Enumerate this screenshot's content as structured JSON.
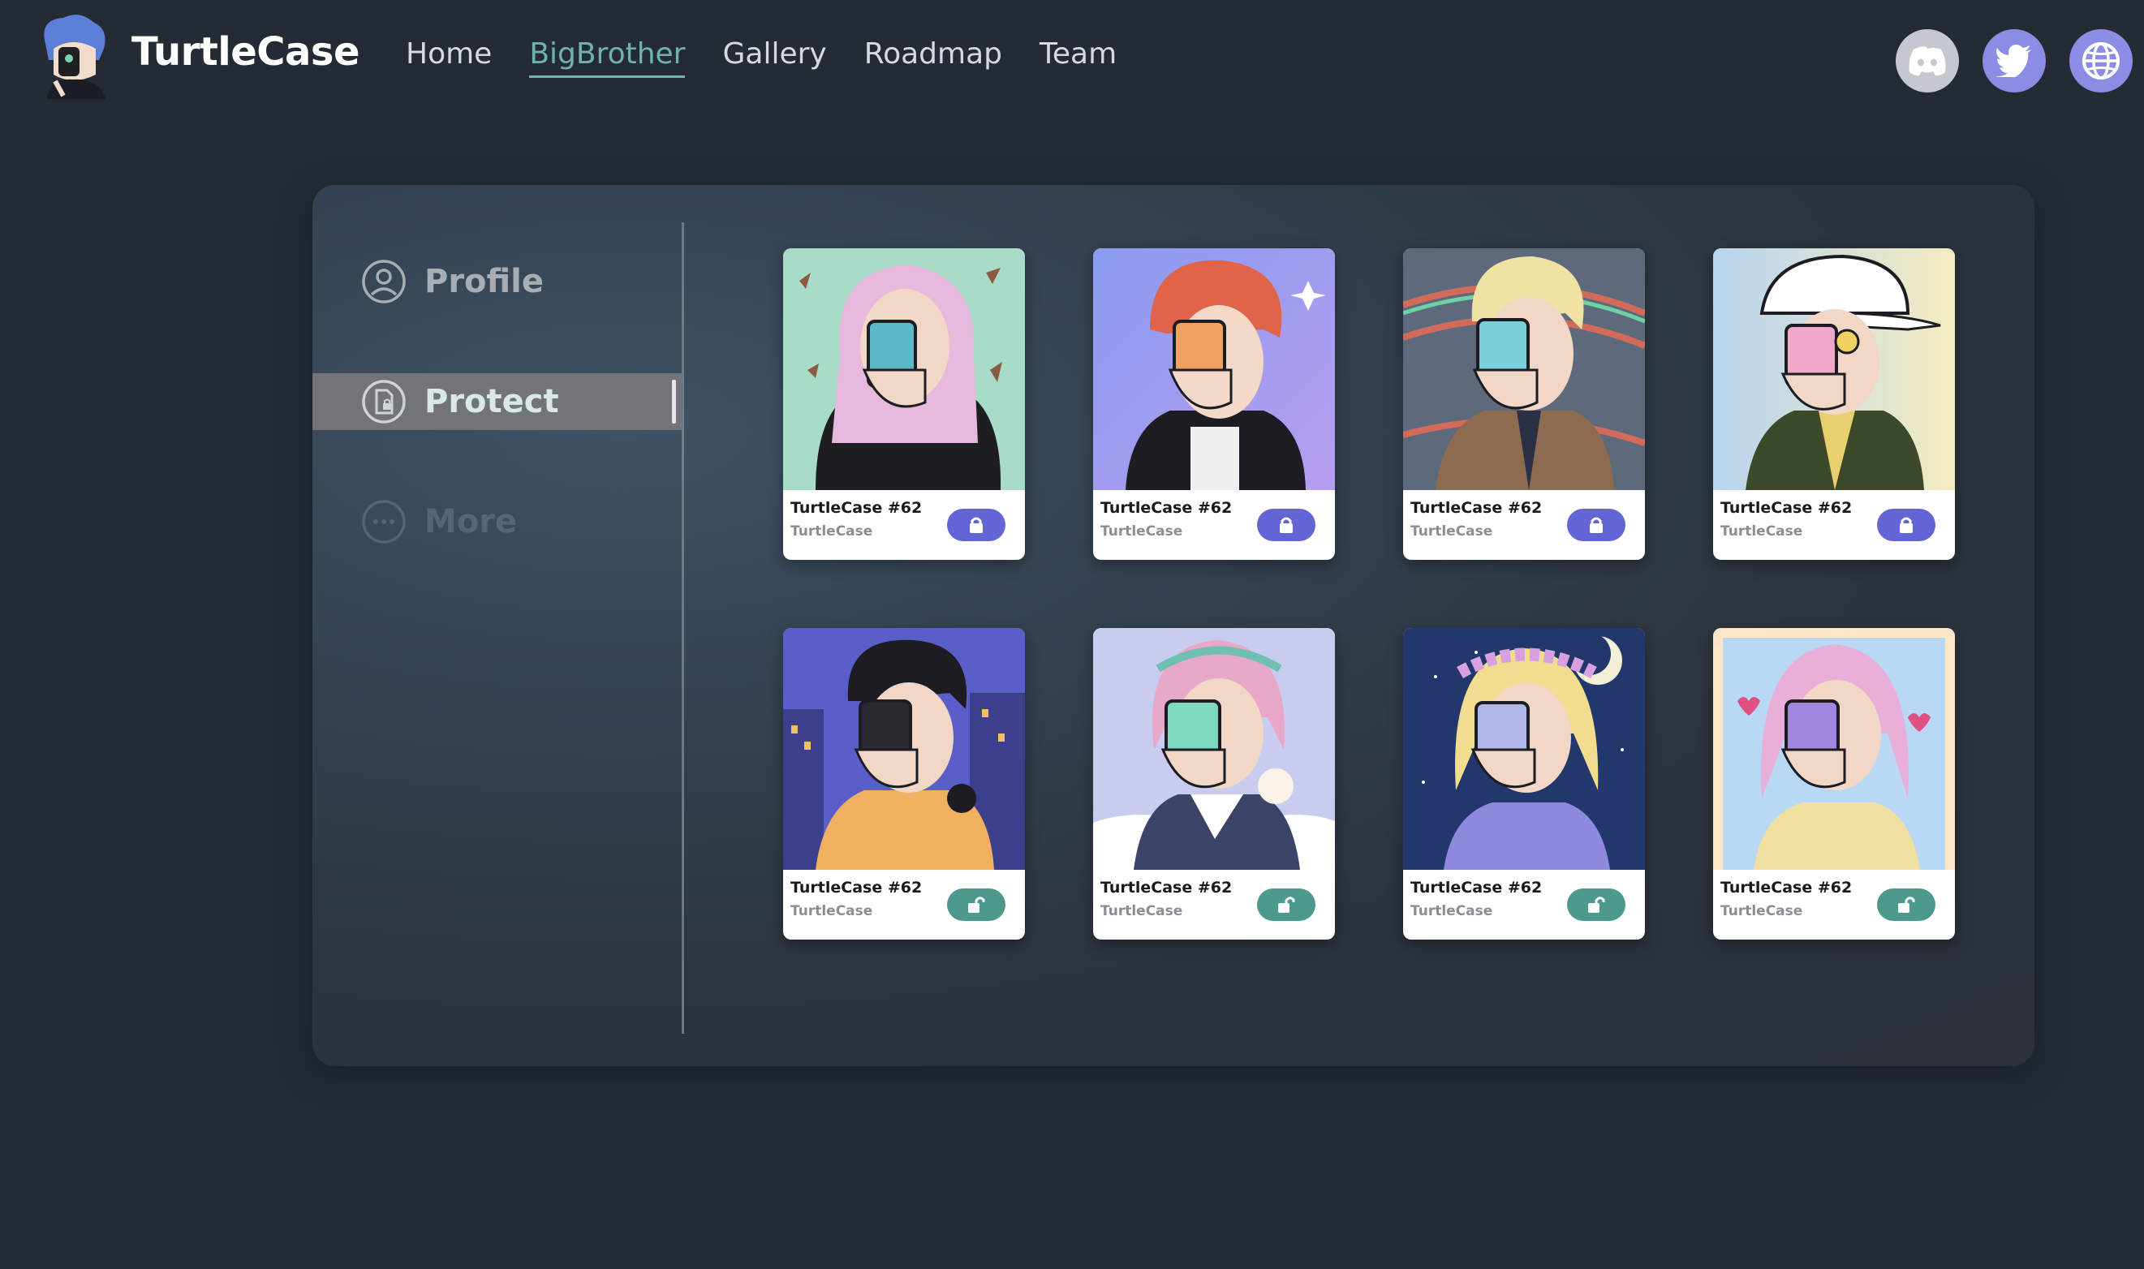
{
  "header": {
    "brand": "TurtleCase",
    "nav": [
      "Home",
      "BigBrother",
      "Gallery",
      "Roadmap",
      "Team"
    ],
    "active_nav": "BigBrother",
    "social_icons": [
      "discord-icon",
      "twitter-icon",
      "globe-icon"
    ]
  },
  "sidebar": {
    "items": [
      {
        "label": "Profile",
        "icon": "user-circle-icon"
      },
      {
        "label": "Protect",
        "icon": "shield-doc-icon",
        "active": true
      },
      {
        "label": "More",
        "icon": "more-dots-icon"
      }
    ]
  },
  "cards": [
    {
      "title": "TurtleCase #62",
      "collection": "TurtleCase",
      "state": "locked"
    },
    {
      "title": "TurtleCase #62",
      "collection": "TurtleCase",
      "state": "locked"
    },
    {
      "title": "TurtleCase #62",
      "collection": "TurtleCase",
      "state": "locked"
    },
    {
      "title": "TurtleCase #62",
      "collection": "TurtleCase",
      "state": "locked"
    },
    {
      "title": "TurtleCase #62",
      "collection": "TurtleCase",
      "state": "unlocked"
    },
    {
      "title": "TurtleCase #62",
      "collection": "TurtleCase",
      "state": "unlocked"
    },
    {
      "title": "TurtleCase #62",
      "collection": "TurtleCase",
      "state": "unlocked"
    },
    {
      "title": "TurtleCase #62",
      "collection": "TurtleCase",
      "state": "unlocked"
    }
  ],
  "colors": {
    "background": "#242b35",
    "accent_nav": "#6fb4a8",
    "locked_button": "#6365d6",
    "unlocked_button": "#4b9a8c"
  }
}
